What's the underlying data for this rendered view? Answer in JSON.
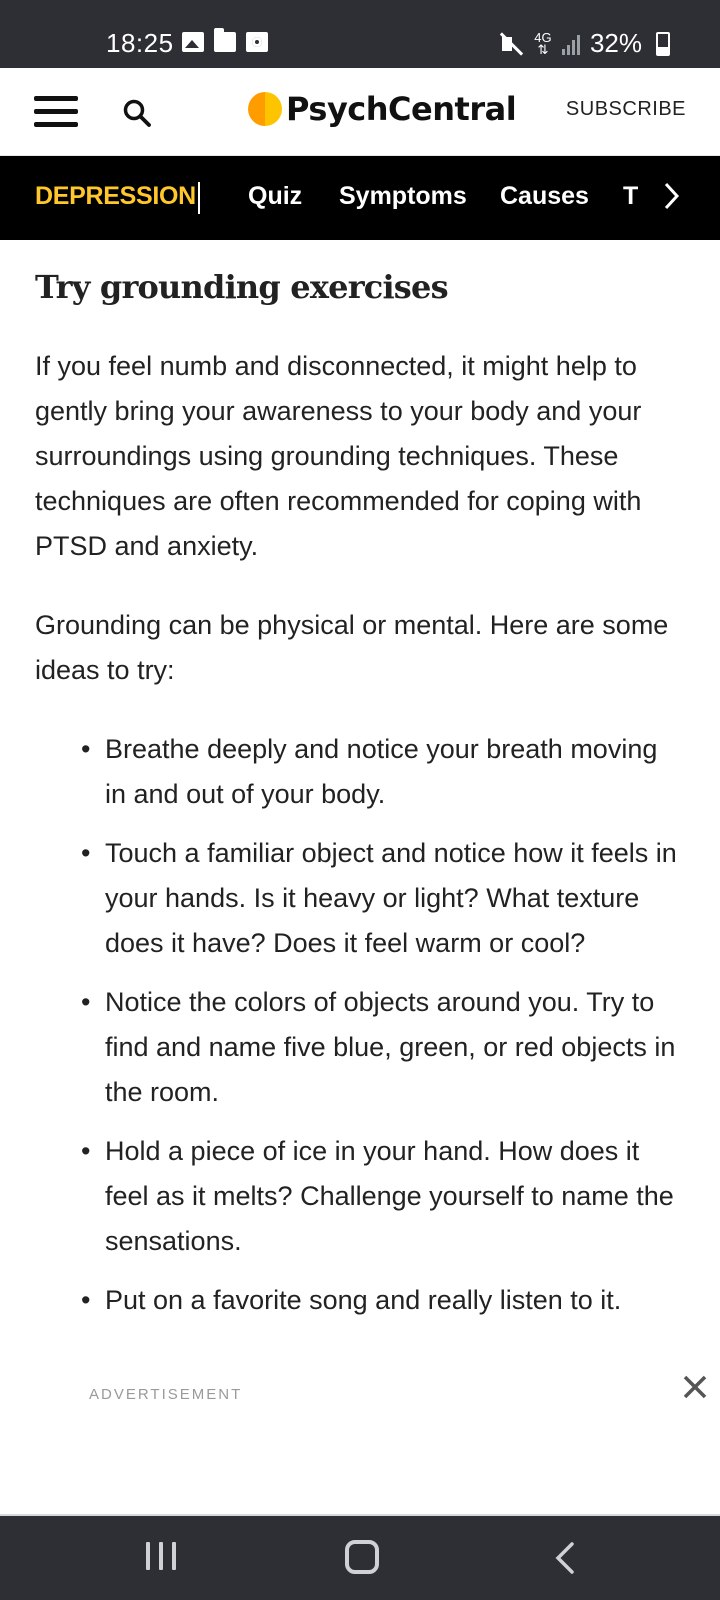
{
  "status_bar": {
    "time": "18:25",
    "left_icons": [
      "image-icon",
      "folder-icon",
      "camera-icon"
    ],
    "right_icons": [
      "mute-icon",
      "4g-icon",
      "signal-icon",
      "battery-icon"
    ],
    "network": "4G",
    "battery": "32%"
  },
  "header": {
    "logo_text": "PsychCentral",
    "subscribe_label": "SUBSCRIBE",
    "menu_icon": "hamburger-icon",
    "search_icon": "search-icon",
    "logo_color": "#ff9d00"
  },
  "category_nav": {
    "primary": "DEPRESSION",
    "primary_color": "#ffc72c",
    "items": [
      "Quiz",
      "Symptoms",
      "Causes",
      "T"
    ],
    "more_icon": "chevron-right-icon"
  },
  "article": {
    "heading": "Try grounding exercises",
    "paragraphs": [
      "If you feel numb and disconnected, it might help to gently bring your awareness to your body and your surroundings using grounding techniques. These techniques are often recommended for coping with PTSD and anxiety.",
      "Grounding can be physical or mental. Here are some ideas to try:"
    ],
    "ideas": [
      "Breathe deeply and notice your breath moving in and out of your body.",
      "Touch a familiar object and notice how it feels in your hands. Is it heavy or light? What texture does it have? Does it feel warm or cool?",
      "Notice the colors of objects around you. Try to find and name five blue, green, or red objects in the room.",
      "Hold a piece of ice in your hand. How does it feel as it melts? Challenge yourself to name the sensations.",
      "Put on a favorite song and really listen to it."
    ]
  },
  "ad": {
    "label": "ADVERTISEMENT",
    "close_icon": "close-icon"
  },
  "system_nav": {
    "buttons": [
      "recents-icon",
      "home-icon",
      "back-icon"
    ]
  }
}
